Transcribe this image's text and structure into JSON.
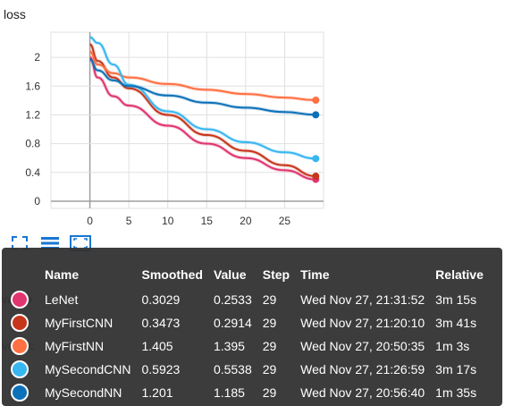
{
  "chart_title": "loss",
  "chart_data": {
    "type": "line",
    "title": "loss",
    "xlabel": "",
    "ylabel": "",
    "xlim": [
      -5,
      30
    ],
    "ylim": [
      -0.1,
      2.35
    ],
    "x_ticks": [
      0,
      5,
      10,
      15,
      20,
      25
    ],
    "y_ticks": [
      0,
      0.4,
      0.8,
      1.2,
      1.6,
      2
    ],
    "grid": true,
    "series": [
      {
        "name": "LeNet",
        "color": "#e0356f",
        "x": [
          0,
          1,
          3,
          5,
          10,
          15,
          20,
          25,
          29
        ],
        "y": [
          2.0,
          1.72,
          1.46,
          1.33,
          1.05,
          0.8,
          0.6,
          0.43,
          0.3029
        ]
      },
      {
        "name": "MyFirstCNN",
        "color": "#c6361b",
        "x": [
          0,
          1,
          3,
          5,
          10,
          15,
          20,
          25,
          29
        ],
        "y": [
          2.18,
          1.95,
          1.72,
          1.57,
          1.2,
          0.92,
          0.7,
          0.5,
          0.3473
        ]
      },
      {
        "name": "MyFirstNN",
        "color": "#ff7043",
        "x": [
          0,
          1,
          3,
          5,
          10,
          15,
          20,
          25,
          29
        ],
        "y": [
          2.08,
          1.9,
          1.78,
          1.72,
          1.63,
          1.55,
          1.49,
          1.44,
          1.405
        ]
      },
      {
        "name": "MySecondCNN",
        "color": "#38b6f0",
        "x": [
          0,
          1,
          3,
          5,
          10,
          15,
          20,
          25,
          29
        ],
        "y": [
          2.28,
          2.2,
          1.9,
          1.62,
          1.25,
          1.0,
          0.82,
          0.68,
          0.5923
        ]
      },
      {
        "name": "MySecondNN",
        "color": "#0c71b8",
        "x": [
          0,
          1,
          3,
          5,
          10,
          15,
          20,
          25,
          29
        ],
        "y": [
          1.97,
          1.82,
          1.68,
          1.6,
          1.47,
          1.37,
          1.3,
          1.24,
          1.201
        ]
      }
    ]
  },
  "toolbar": {
    "icons": [
      "expand-icon",
      "lines-icon",
      "fit-domain-icon"
    ],
    "color": "#1976d2"
  },
  "background_clips": [
    "val_lo",
    "val_sc"
  ],
  "tooltip": {
    "headers": [
      "Name",
      "Smoothed",
      "Value",
      "Step",
      "Time",
      "Relative"
    ],
    "rows": [
      {
        "name": "LeNet",
        "color": "#e0356f",
        "smoothed": "0.3029",
        "value": "0.2533",
        "step": "29",
        "time": "Wed Nov 27, 21:31:52",
        "relative": "3m 15s"
      },
      {
        "name": "MyFirstCNN",
        "color": "#c6361b",
        "smoothed": "0.3473",
        "value": "0.2914",
        "step": "29",
        "time": "Wed Nov 27, 21:20:10",
        "relative": "3m 41s"
      },
      {
        "name": "MyFirstNN",
        "color": "#ff7043",
        "smoothed": "1.405",
        "value": "1.395",
        "step": "29",
        "time": "Wed Nov 27, 20:50:35",
        "relative": "1m 3s"
      },
      {
        "name": "MySecondCNN",
        "color": "#38b6f0",
        "smoothed": "0.5923",
        "value": "0.5538",
        "step": "29",
        "time": "Wed Nov 27, 21:26:59",
        "relative": "3m 17s"
      },
      {
        "name": "MySecondNN",
        "color": "#0c71b8",
        "smoothed": "1.201",
        "value": "1.185",
        "step": "29",
        "time": "Wed Nov 27, 20:56:40",
        "relative": "1m 35s"
      }
    ]
  }
}
